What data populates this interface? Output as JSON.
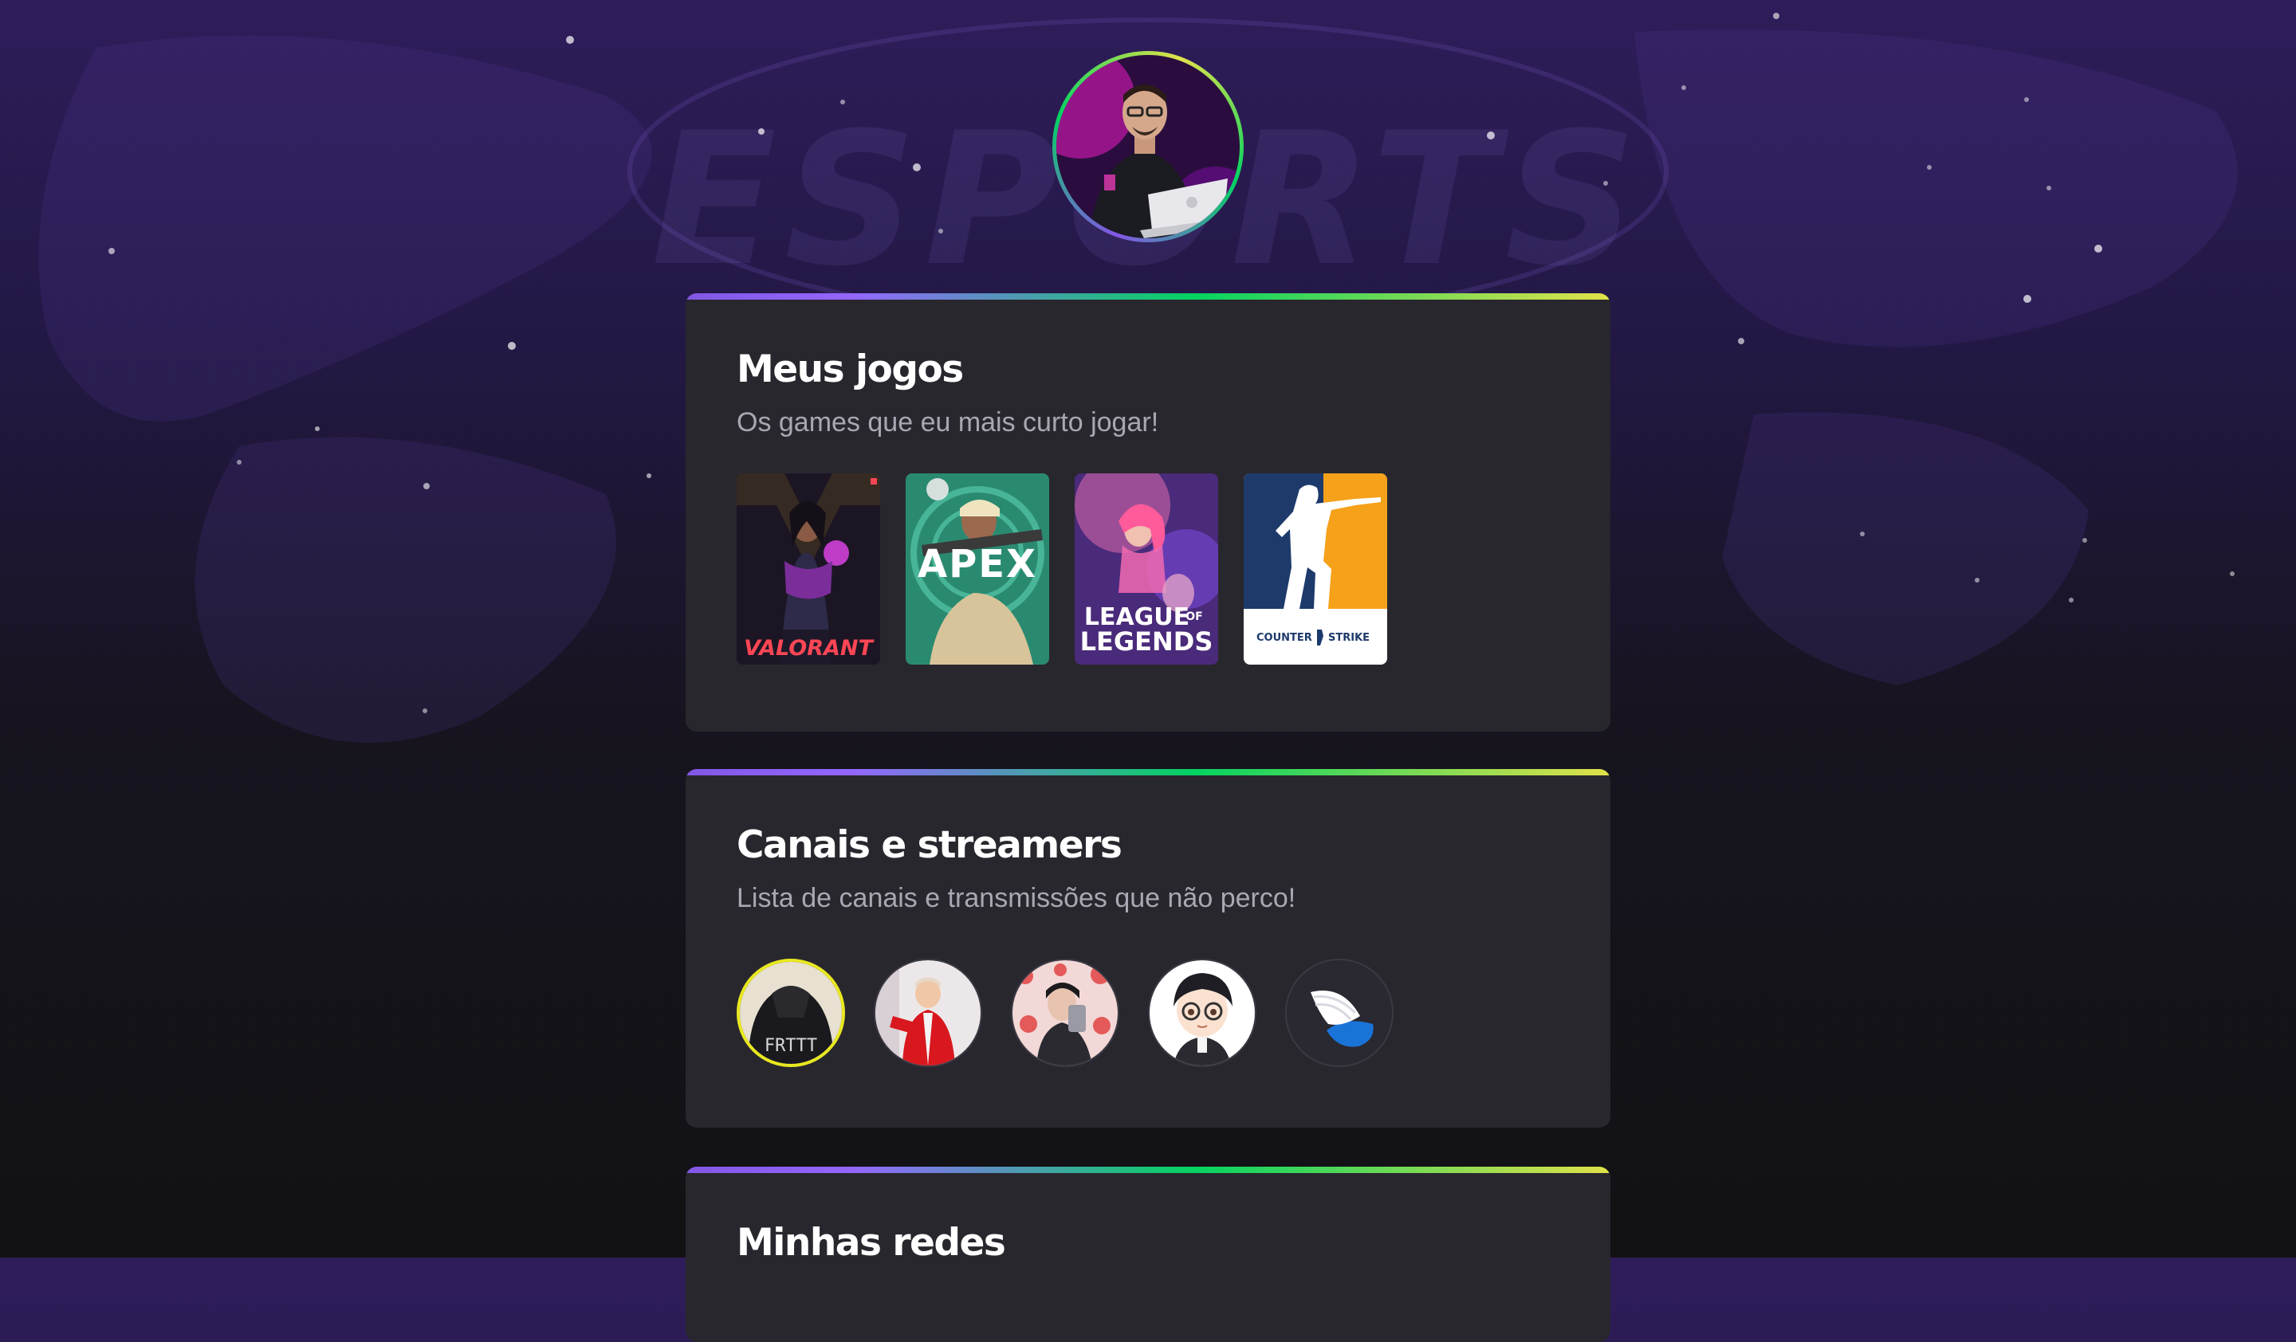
{
  "profile": {
    "avatar_icon": "gamer-avatar-photo"
  },
  "games_section": {
    "title": "Meus jogos",
    "subtitle": "Os games que eu mais curto jogar!",
    "games": [
      {
        "name": "VALORANT",
        "icon": "valorant-cover"
      },
      {
        "name": "APEX",
        "icon": "apex-legends-cover"
      },
      {
        "name_line1": "LEAGUE",
        "name_of": "OF",
        "name_line2": "LEGENDS",
        "icon": "league-of-legends-cover"
      },
      {
        "name_a": "COUNTER",
        "name_b": "STRIKE",
        "icon": "counter-strike-cover"
      }
    ]
  },
  "streamers_section": {
    "title": "Canais e streamers",
    "subtitle": "Lista de canais e transmissões que não perco!",
    "streamers": [
      {
        "icon": "streamer-avatar-1",
        "jersey_text": "FRTTT"
      },
      {
        "icon": "streamer-avatar-2"
      },
      {
        "icon": "streamer-avatar-3"
      },
      {
        "icon": "streamer-avatar-4"
      },
      {
        "icon": "streamer-avatar-5"
      }
    ]
  },
  "social_section": {
    "title": "Minhas redes"
  },
  "colors": {
    "card": "#29272e",
    "title": "#ffffff",
    "subtitle": "#a8a8b3",
    "accent_purple": "#8257e5",
    "accent_green": "#04d361",
    "accent_yellow": "#e1e14a"
  }
}
